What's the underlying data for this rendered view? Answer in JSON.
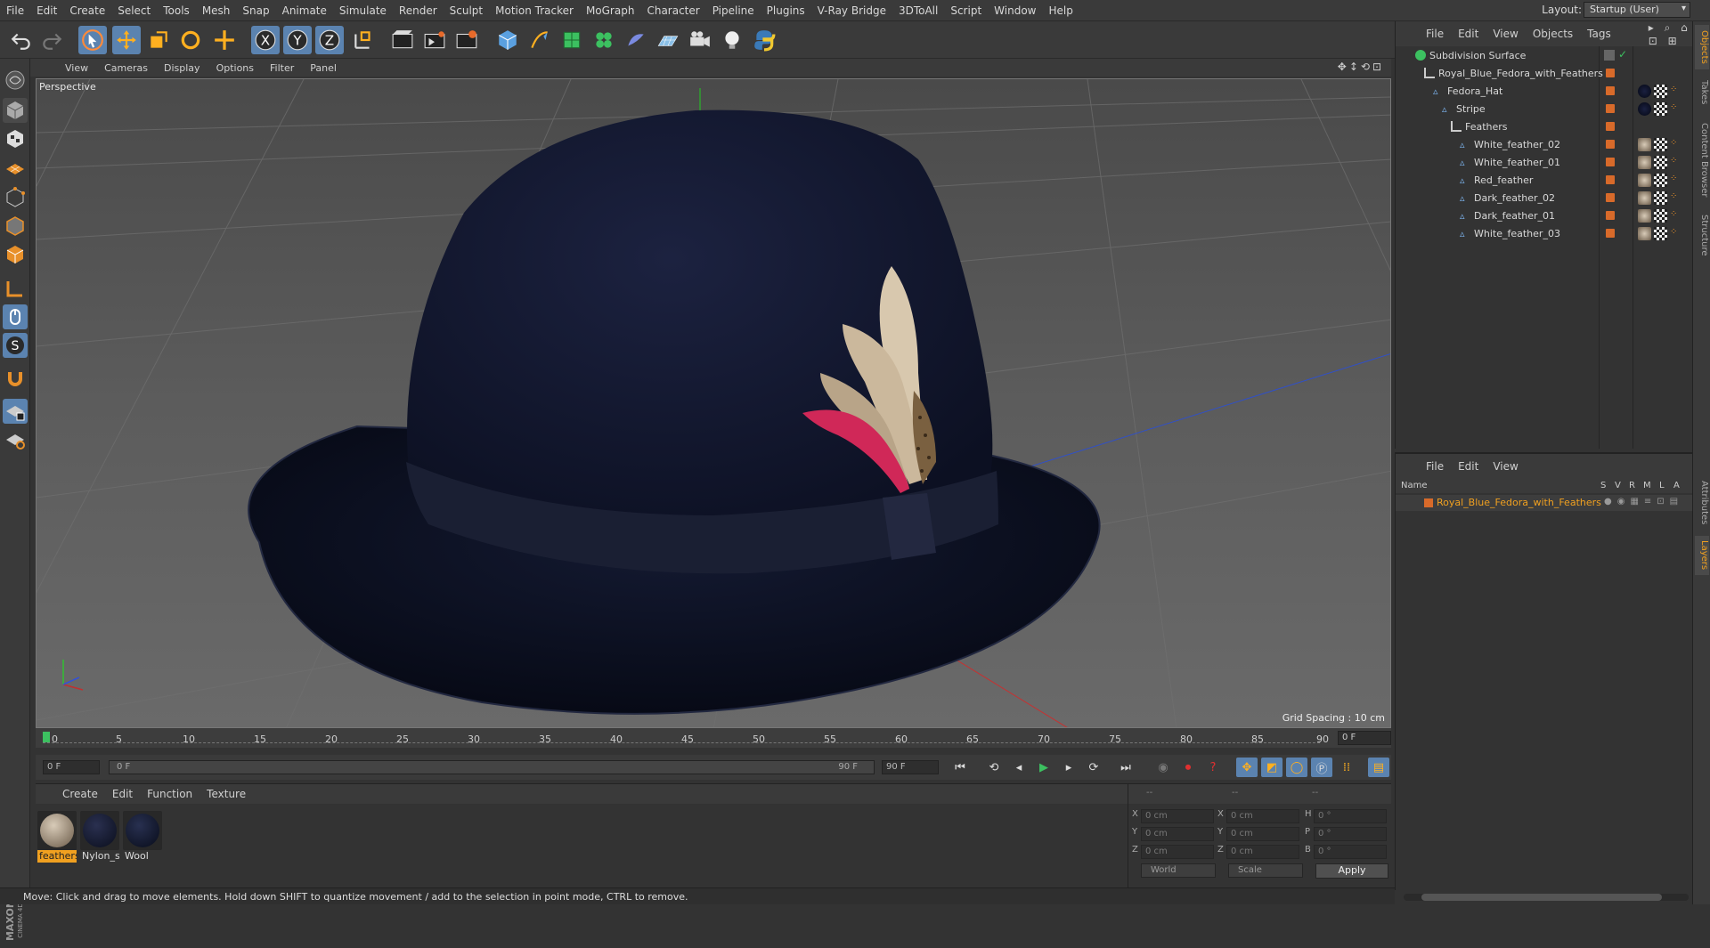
{
  "menubar": {
    "items": [
      "File",
      "Edit",
      "Create",
      "Select",
      "Tools",
      "Mesh",
      "Snap",
      "Animate",
      "Simulate",
      "Render",
      "Sculpt",
      "Motion Tracker",
      "MoGraph",
      "Character",
      "Pipeline",
      "Plugins",
      "V-Ray Bridge",
      "3DToAll",
      "Script",
      "Window",
      "Help"
    ],
    "layout_label": "Layout:",
    "layout_value": "Startup (User)"
  },
  "viewport": {
    "menu": [
      "View",
      "Cameras",
      "Display",
      "Options",
      "Filter",
      "Panel"
    ],
    "label": "Perspective",
    "grid_spacing": "Grid Spacing : 10 cm"
  },
  "timeline": {
    "ticks": [
      "0",
      "5",
      "10",
      "15",
      "20",
      "25",
      "30",
      "35",
      "40",
      "45",
      "50",
      "55",
      "60",
      "65",
      "70",
      "75",
      "80",
      "85",
      "90"
    ],
    "current_frame": "0 F",
    "start_field": "0 F",
    "slider_start": "0 F",
    "slider_end": "90 F",
    "end_field": "90 F"
  },
  "materials": {
    "menu": [
      "Create",
      "Edit",
      "Function",
      "Texture"
    ],
    "items": [
      {
        "name": "feathers",
        "color": "#8a7a66"
      },
      {
        "name": "Nylon_s",
        "color": "#101628"
      },
      {
        "name": "Wool",
        "color": "#0e1426"
      }
    ]
  },
  "coords": {
    "headers": [
      "--",
      "--",
      "--"
    ],
    "rows": [
      {
        "a": "X",
        "av": "0 cm",
        "b": "X",
        "bv": "0 cm",
        "c": "H",
        "cv": "0 °"
      },
      {
        "a": "Y",
        "av": "0 cm",
        "b": "Y",
        "bv": "0 cm",
        "c": "P",
        "cv": "0 °"
      },
      {
        "a": "Z",
        "av": "0 cm",
        "b": "Z",
        "bv": "0 cm",
        "c": "B",
        "cv": "0 °"
      }
    ],
    "world": "World",
    "scale": "Scale",
    "apply": "Apply"
  },
  "status": "Move: Click and drag to move elements. Hold down SHIFT to quantize movement / add to the selection in point mode, CTRL to remove.",
  "objects": {
    "menu": [
      "File",
      "Edit",
      "View",
      "Objects",
      "Tags"
    ],
    "rows": [
      {
        "name": "Subdivision Surface",
        "icon": "subdivision-icon"
      },
      {
        "name": "Royal_Blue_Fedora_with_Feathers",
        "icon": "null-icon"
      },
      {
        "name": "Fedora_Hat",
        "icon": "polygon-icon"
      },
      {
        "name": "Stripe",
        "icon": "polygon-icon"
      },
      {
        "name": "Feathers",
        "icon": "null-icon"
      },
      {
        "name": "White_feather_02",
        "icon": "polygon-icon"
      },
      {
        "name": "White_feather_01",
        "icon": "polygon-icon"
      },
      {
        "name": "Red_feather",
        "icon": "polygon-icon"
      },
      {
        "name": "Dark_feather_02",
        "icon": "polygon-icon"
      },
      {
        "name": "Dark_feather_01",
        "icon": "polygon-icon"
      },
      {
        "name": "White_feather_03",
        "icon": "polygon-icon"
      }
    ]
  },
  "layers": {
    "menu": [
      "File",
      "Edit",
      "View"
    ],
    "columns": {
      "name": "Name",
      "flags": [
        "S",
        "V",
        "R",
        "M",
        "L",
        "A"
      ]
    },
    "rows": [
      {
        "name": "Royal_Blue_Fedora_with_Feathers",
        "color": "#d86a2a"
      }
    ]
  },
  "right_tabs": [
    "Objects",
    "Takes",
    "Content Browser",
    "Structure",
    "Attributes",
    "Layers"
  ],
  "brand": "MAXON CINEMA 4D"
}
